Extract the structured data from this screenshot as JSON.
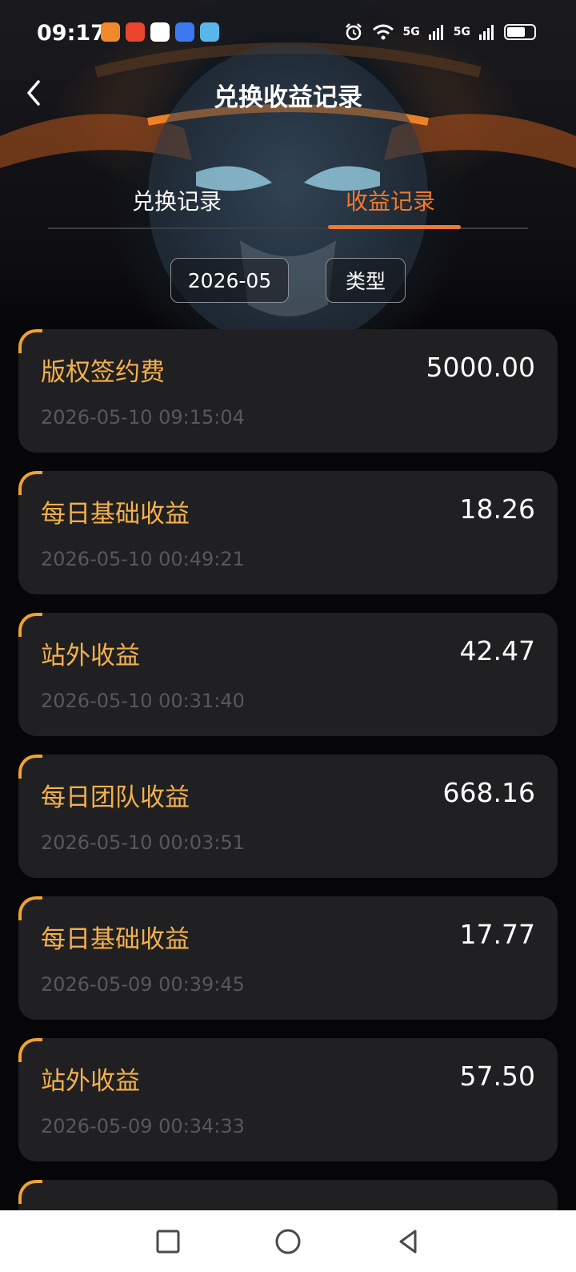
{
  "status_bar": {
    "time": "09:17",
    "network_1": "5G",
    "network_2": "5G",
    "icons": [
      "orange-heart-app-icon",
      "red-app-icon",
      "qq-penguin-icon",
      "blue-app-icon",
      "book-app-icon",
      "alarm-icon",
      "wifi-icon",
      "signal-icon",
      "signal-icon",
      "battery-icon"
    ]
  },
  "header": {
    "title": "兑换收益记录",
    "back_icon": "chevron-left-icon"
  },
  "tabs": [
    {
      "label": "兑换记录",
      "active": false
    },
    {
      "label": "收益记录",
      "active": true
    }
  ],
  "filters": {
    "month": "2026-05",
    "type": "类型"
  },
  "colors": {
    "accent": "#f07a2e",
    "type_text": "#f5b04a",
    "card_bg": "#202022",
    "date_text": "#56585c"
  },
  "records": [
    {
      "type": "版权签约费",
      "amount": "5000.00",
      "time": "2026-05-10 09:15:04"
    },
    {
      "type": "每日基础收益",
      "amount": "18.26",
      "time": "2026-05-10 00:49:21"
    },
    {
      "type": "站外收益",
      "amount": "42.47",
      "time": "2026-05-10 00:31:40"
    },
    {
      "type": "每日团队收益",
      "amount": "668.16",
      "time": "2026-05-10 00:03:51"
    },
    {
      "type": "每日基础收益",
      "amount": "17.77",
      "time": "2026-05-09 00:39:45"
    },
    {
      "type": "站外收益",
      "amount": "57.50",
      "time": "2026-05-09 00:34:33"
    }
  ],
  "nav": {
    "icons": [
      "square-recent-icon",
      "circle-home-icon",
      "triangle-back-icon"
    ]
  }
}
